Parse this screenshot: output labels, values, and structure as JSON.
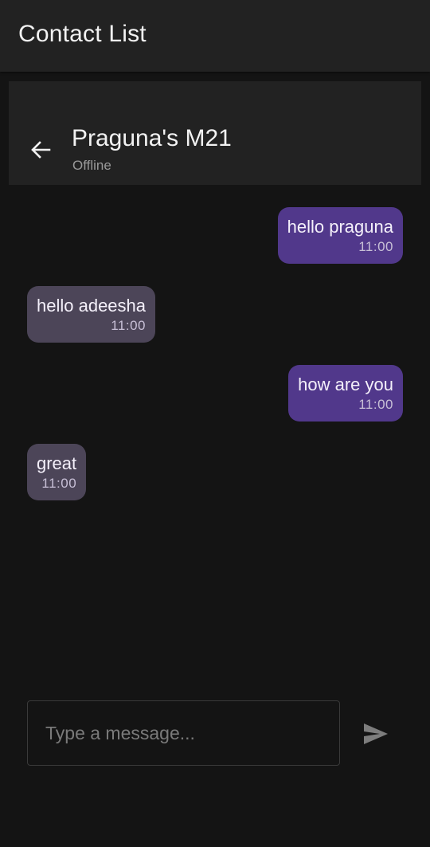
{
  "appbar": {
    "title": "Contact List"
  },
  "chat_header": {
    "back_icon": "arrow-left-icon",
    "contact_name": "Praguna's M21",
    "status": "Offline"
  },
  "messages": [
    {
      "direction": "sent",
      "text": "hello praguna",
      "time": "11:00"
    },
    {
      "direction": "received",
      "text": "hello adeesha",
      "time": "11:00"
    },
    {
      "direction": "sent",
      "text": "how are you",
      "time": "11:00"
    },
    {
      "direction": "received",
      "text": "great",
      "time": "11:00"
    }
  ],
  "composer": {
    "value": "",
    "placeholder": "Type a message...",
    "send_icon": "send-icon"
  },
  "colors": {
    "background": "#141414",
    "bar": "#222222",
    "sent_bubble": "#51388b",
    "received_bubble": "#4c4558"
  }
}
